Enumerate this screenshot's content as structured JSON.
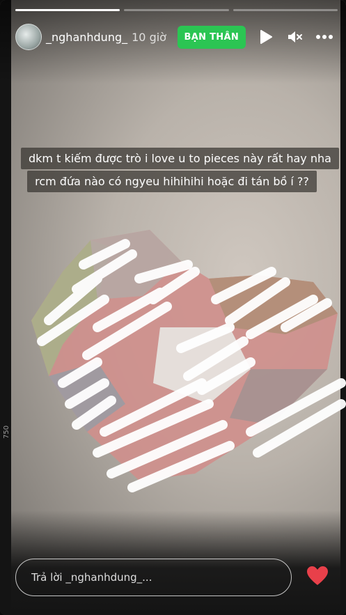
{
  "story": {
    "username": "_nghanhdung_",
    "time": "10 giờ",
    "badge": "BẠN THÂN",
    "caption_lines": [
      "dkm t kiếm được trò i love u to pieces này rất hay nha",
      "rcm đứa nào có ngyeu hihihihi hoặc đi tán bồ í ??"
    ],
    "progress_segments": [
      1.0,
      0.0,
      0.0
    ],
    "reply_placeholder": "Trả lời _nghanhdung_...",
    "side_label": "750",
    "icons": [
      "play-icon",
      "mute-icon",
      "more-icon",
      "heart-icon"
    ],
    "colors": {
      "badge": "#2bc553",
      "heart": "#e8404a"
    }
  }
}
